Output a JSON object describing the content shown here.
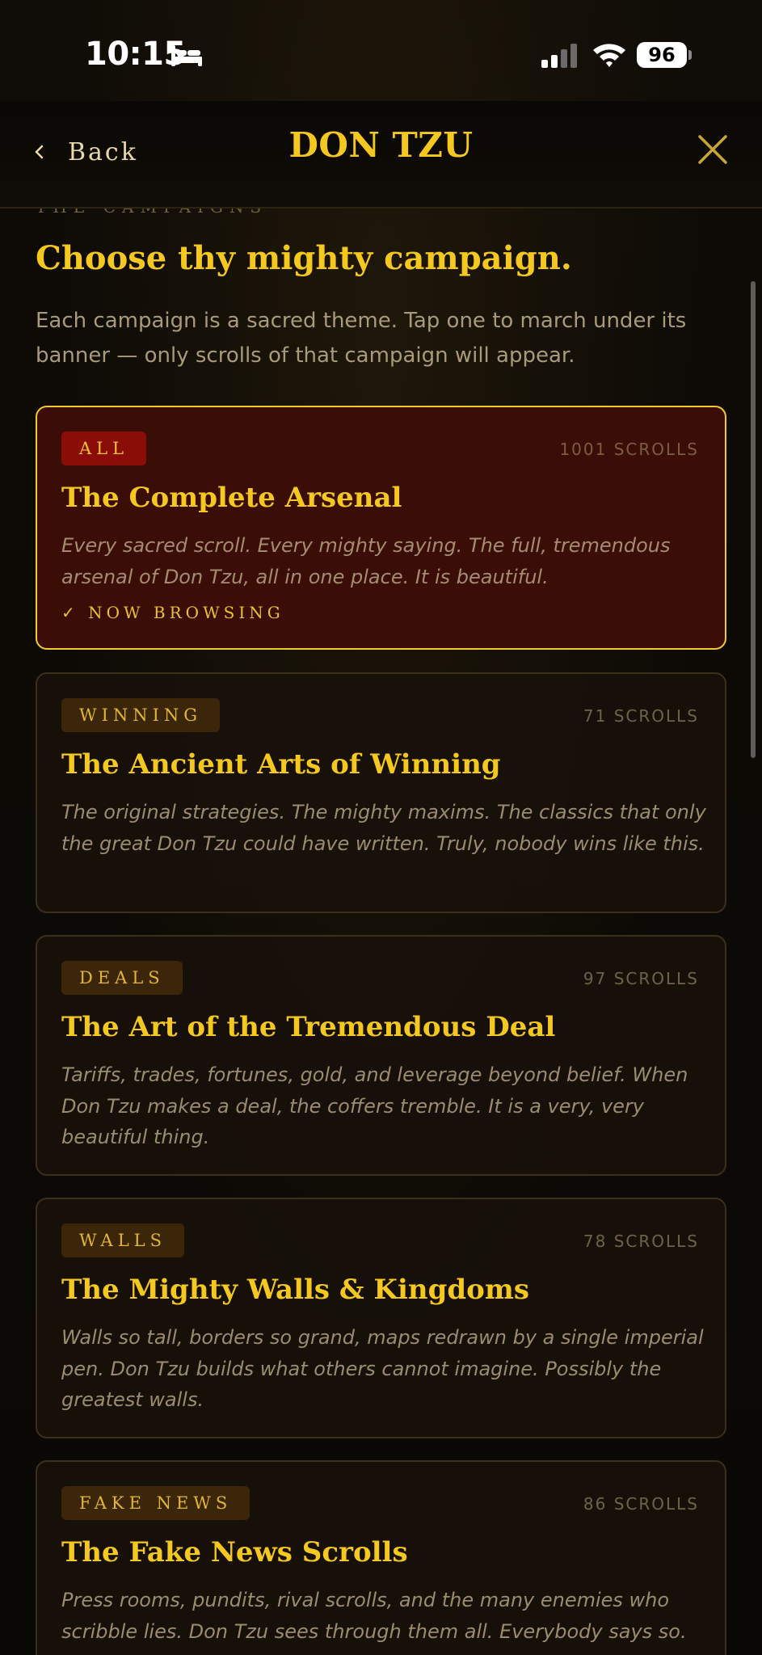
{
  "status": {
    "time": "10:15",
    "battery": "96"
  },
  "nav": {
    "back_label": "Back",
    "title": "DON TZU"
  },
  "header": {
    "eyebrow": "THE CAMPAIGNS",
    "heading": "Choose thy mighty campaign.",
    "intro": "Each campaign is a sacred theme. Tap one to march under its banner — only scrolls of that campaign will appear."
  },
  "campaigns": [
    {
      "badge": "ALL",
      "count": "1001 SCROLLS",
      "title": "The Complete Arsenal",
      "description": "Every sacred scroll. Every mighty saying. The full, tremendous arsenal of Don Tzu, all in one place. It is beautiful.",
      "status": "✓ NOW BROWSING",
      "selected": true
    },
    {
      "badge": "WINNING",
      "count": "71 SCROLLS",
      "title": "The Ancient Arts of Winning",
      "description": "The original strategies. The mighty maxims. The classics that only the great Don Tzu could have written. Truly, nobody wins like this.",
      "selected": false
    },
    {
      "badge": "DEALS",
      "count": "97 SCROLLS",
      "title": "The Art of the Tremendous Deal",
      "description": "Tariffs, trades, fortunes, gold, and leverage beyond belief. When Don Tzu makes a deal, the coffers tremble. It is a very, very beautiful thing.",
      "selected": false
    },
    {
      "badge": "WALLS",
      "count": "78 SCROLLS",
      "title": "The Mighty Walls & Kingdoms",
      "description": "Walls so tall, borders so grand, maps redrawn by a single imperial pen. Don Tzu builds what others cannot imagine. Possibly the greatest walls.",
      "selected": false
    },
    {
      "badge": "FAKE NEWS",
      "count": "86 SCROLLS",
      "title": "The Fake News Scrolls",
      "description": "Press rooms, pundits, rival scrolls, and the many enemies who scribble lies. Don Tzu sees through them all. Everybody says so.",
      "selected": false
    }
  ],
  "colors": {
    "accent_gold": "#f4c81e",
    "selected_card_bg": "#3a0e06",
    "selected_badge_bg": "#8a0d08",
    "badge_bg": "#3c2609"
  }
}
